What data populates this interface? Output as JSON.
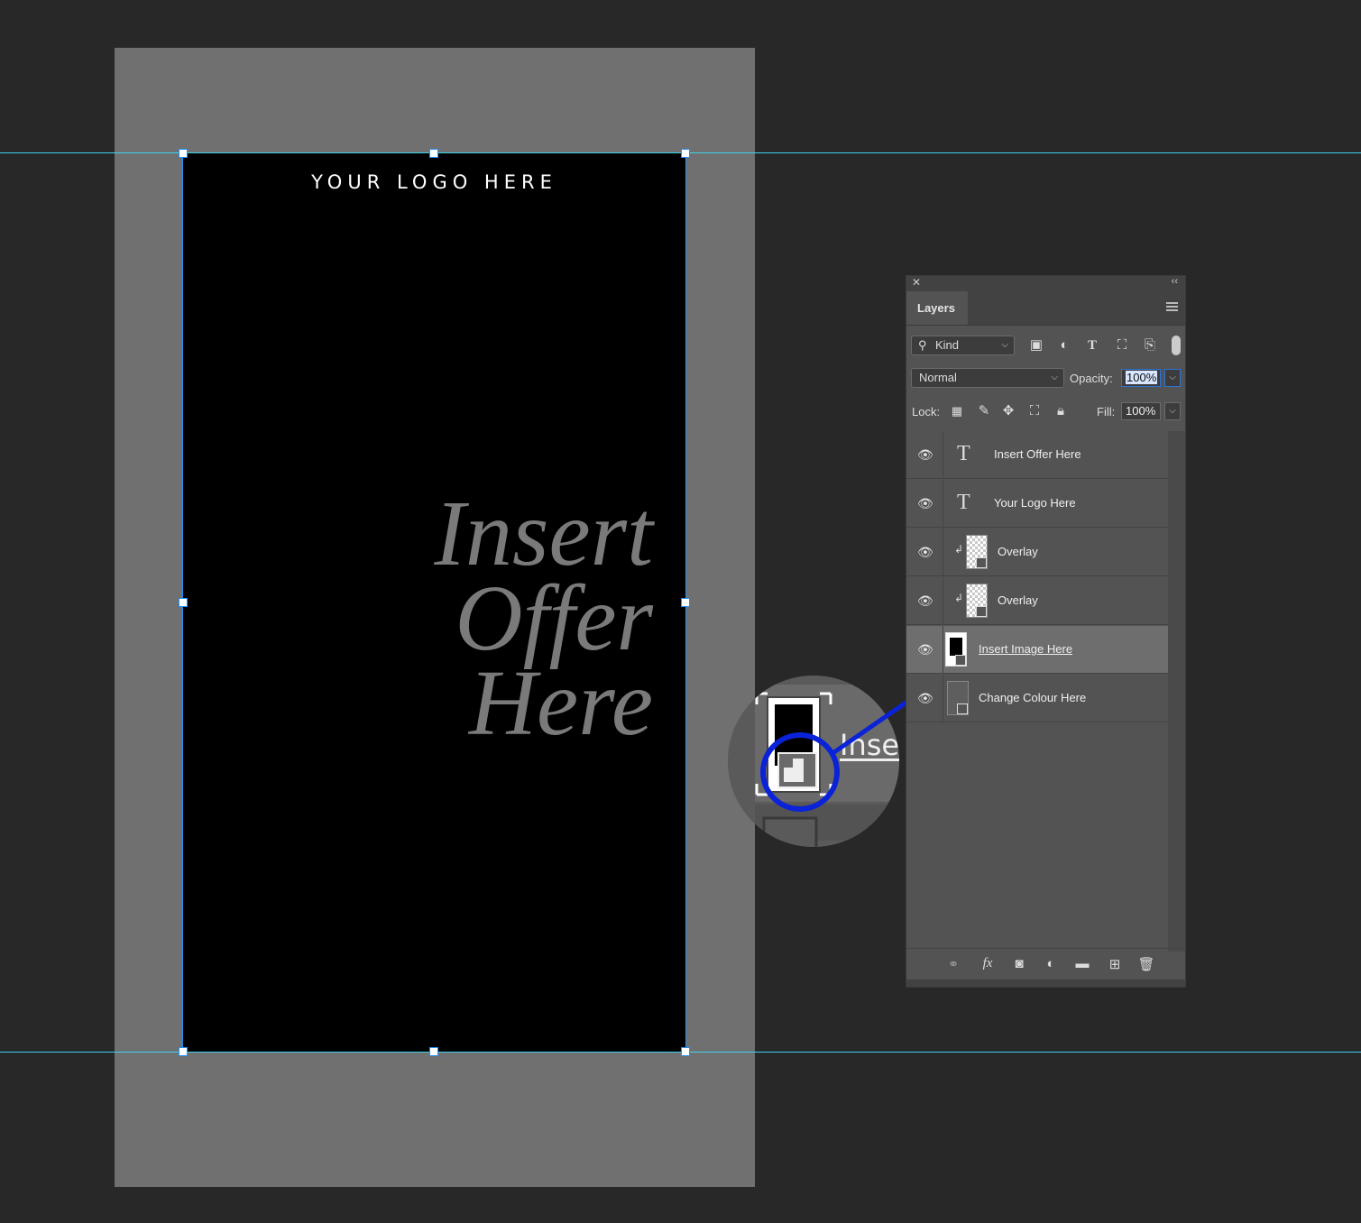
{
  "artboard": {
    "logo": "YOUR LOGO HERE",
    "offer_lines": [
      "Insert",
      "Offer",
      "Here"
    ]
  },
  "zoom_callout": {
    "text": "Inse"
  },
  "panel": {
    "tab": "Layers",
    "filter": {
      "kind_label": "Kind"
    },
    "blend_mode": "Normal",
    "opacity_label": "Opacity:",
    "opacity_value": "100%",
    "lock_label": "Lock:",
    "fill_label": "Fill:",
    "fill_value": "100%",
    "layers": [
      {
        "name": "Insert Offer Here",
        "type": "text",
        "visible": true
      },
      {
        "name": "Your Logo Here",
        "type": "text",
        "visible": true
      },
      {
        "name": "Overlay",
        "type": "smart-object",
        "clipped": true,
        "visible": true
      },
      {
        "name": "Overlay",
        "type": "smart-object",
        "clipped": true,
        "visible": true
      },
      {
        "name": "Insert Image Here",
        "type": "frame-smart-object",
        "selected": true,
        "visible": true
      },
      {
        "name": "Change Colour Here",
        "type": "smart-object",
        "visible": true
      }
    ]
  },
  "colors": {
    "guide": "#3fd3ea",
    "highlight": "#0a22d8",
    "selection": "#1e90ff"
  }
}
